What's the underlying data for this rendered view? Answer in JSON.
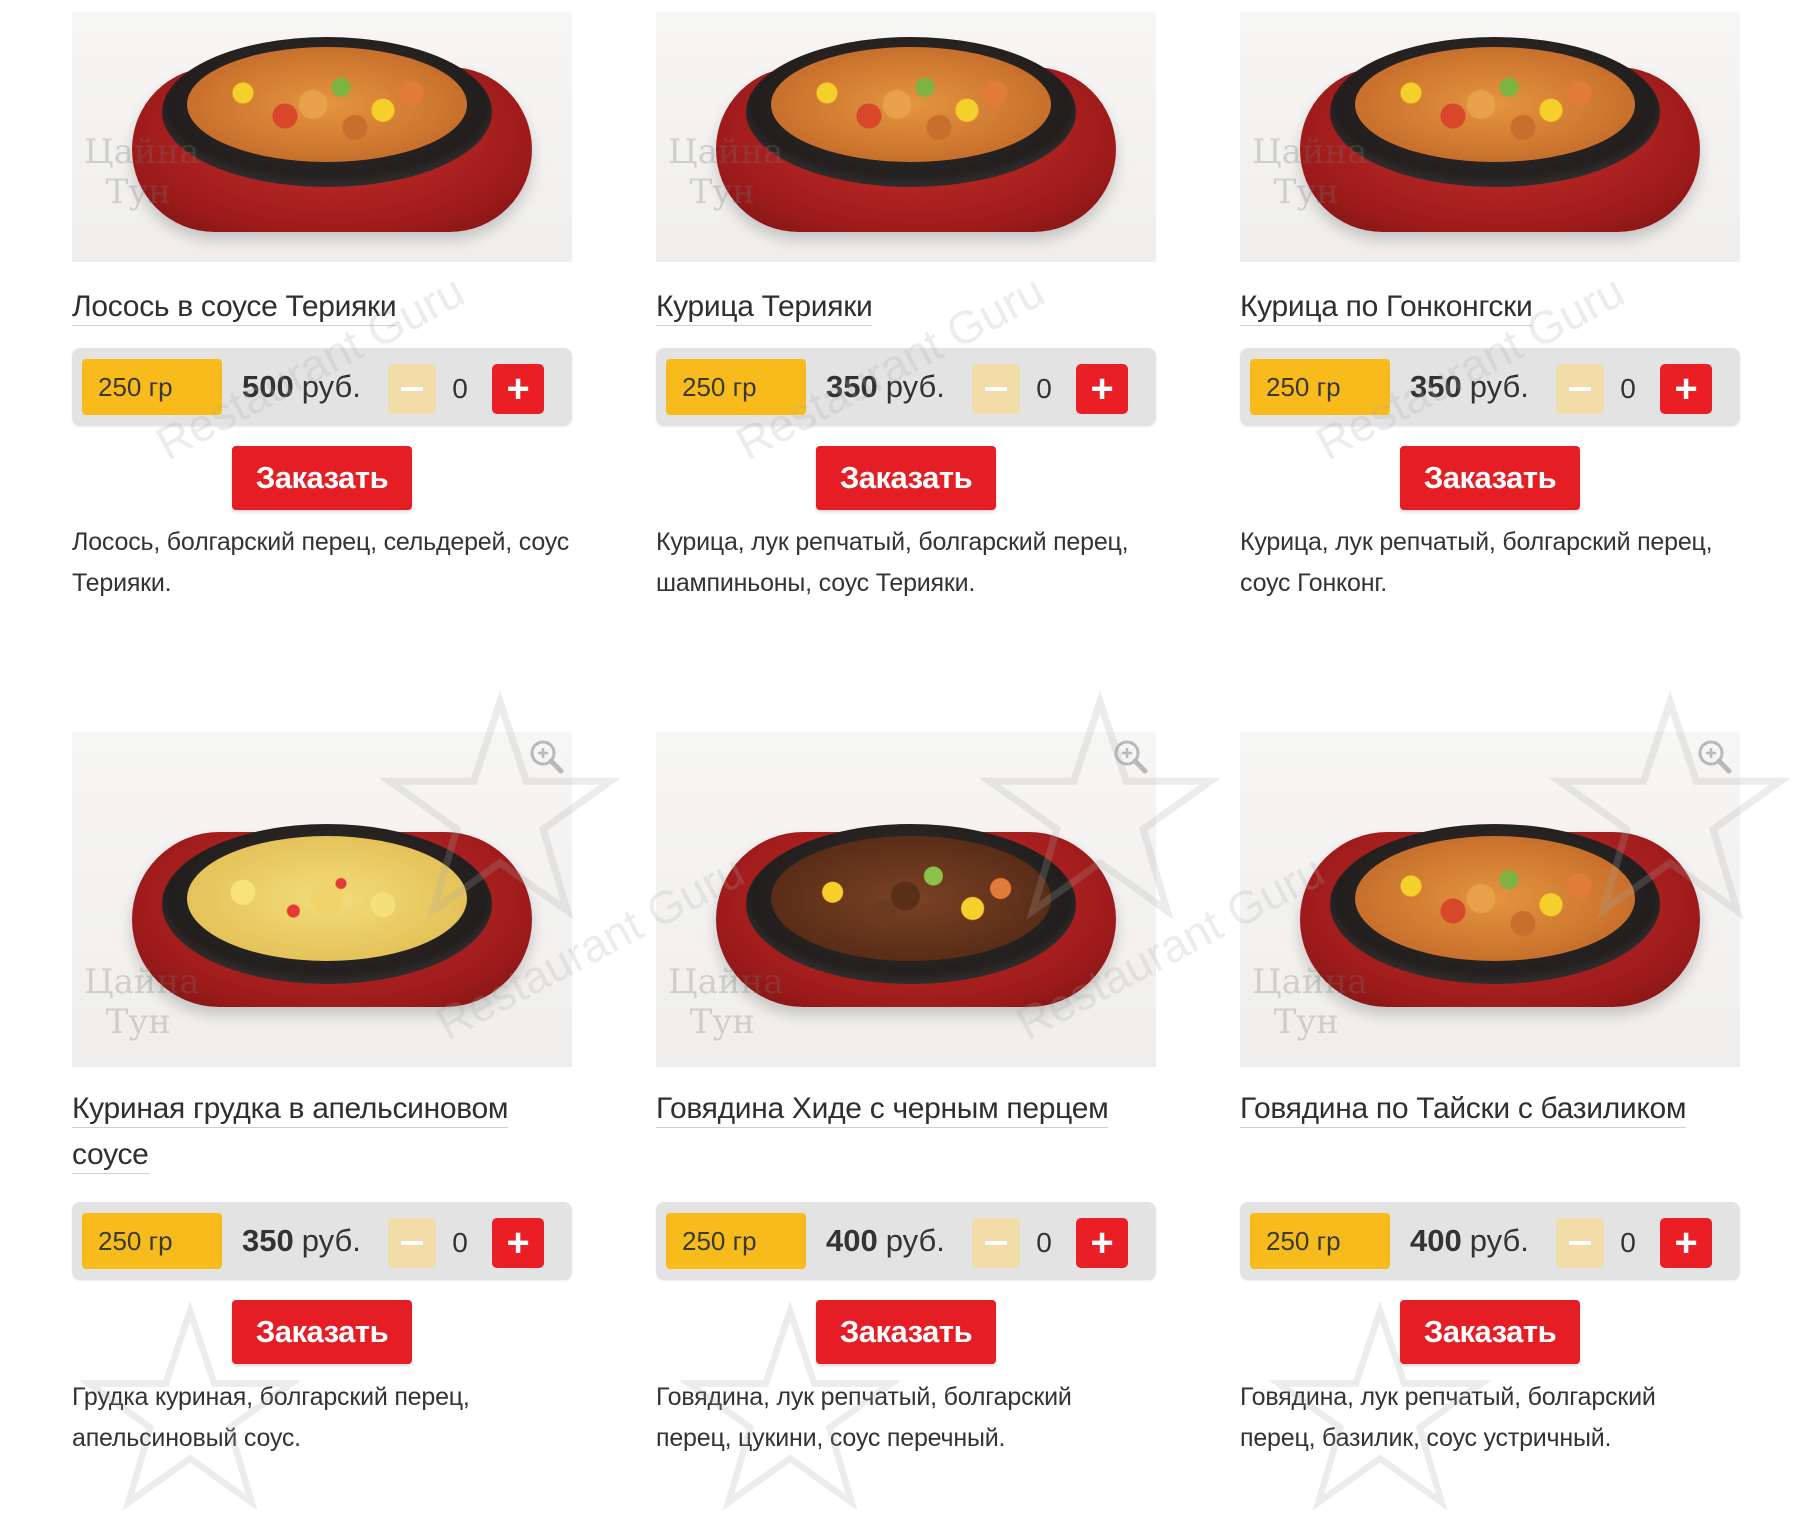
{
  "order_label": "Заказать",
  "price_suffix": "руб.",
  "watermark_text": "Restaurant Guru",
  "restaurant_logo_text": "Цайна Тун",
  "colors": {
    "accent_red": "#e51d24",
    "weight_yellow": "#f7bc1c",
    "minus_beige": "#f2dca8",
    "bar_gray": "#e3e3e3"
  },
  "items": [
    {
      "title": "Лосось в соусе Терияки",
      "weight": "250 гр",
      "price": "500",
      "qty": "0",
      "desc_1": "Лосось, болгарский перец, сельдерей, соус",
      "desc_2": "Терияки."
    },
    {
      "title": "Курица Терияки",
      "weight": "250 гр",
      "price": "350",
      "qty": "0",
      "desc_1": "Курица, лук репчатый, болгарский перец,",
      "desc_2": "шампиньоны, соус Терияки."
    },
    {
      "title": "Курица по Гонконгски",
      "weight": "250 гр",
      "price": "350",
      "qty": "0",
      "desc_1": "Курица, лук репчатый, болгарский перец,",
      "desc_2": "соус Гонконг."
    },
    {
      "title_1": "Куриная грудка в апельсиновом",
      "title_2": "соусе",
      "weight": "250 гр",
      "price": "350",
      "qty": "0",
      "desc_1": "Грудка куриная, болгарский перец,",
      "desc_2": "апельсиновый соус."
    },
    {
      "title": "Говядина Хиде с черным перцем",
      "weight": "250 гр",
      "price": "400",
      "qty": "0",
      "desc_1": "Говядина, лук репчатый, болгарский",
      "desc_2": "перец, цукини, соус перечный."
    },
    {
      "title": "Говядина по Тайски с базиликом",
      "weight": "250 гр",
      "price": "400",
      "qty": "0",
      "desc_1": "Говядина, лук репчатый, болгарский",
      "desc_2": "перец, базилик, соус устричный."
    }
  ]
}
